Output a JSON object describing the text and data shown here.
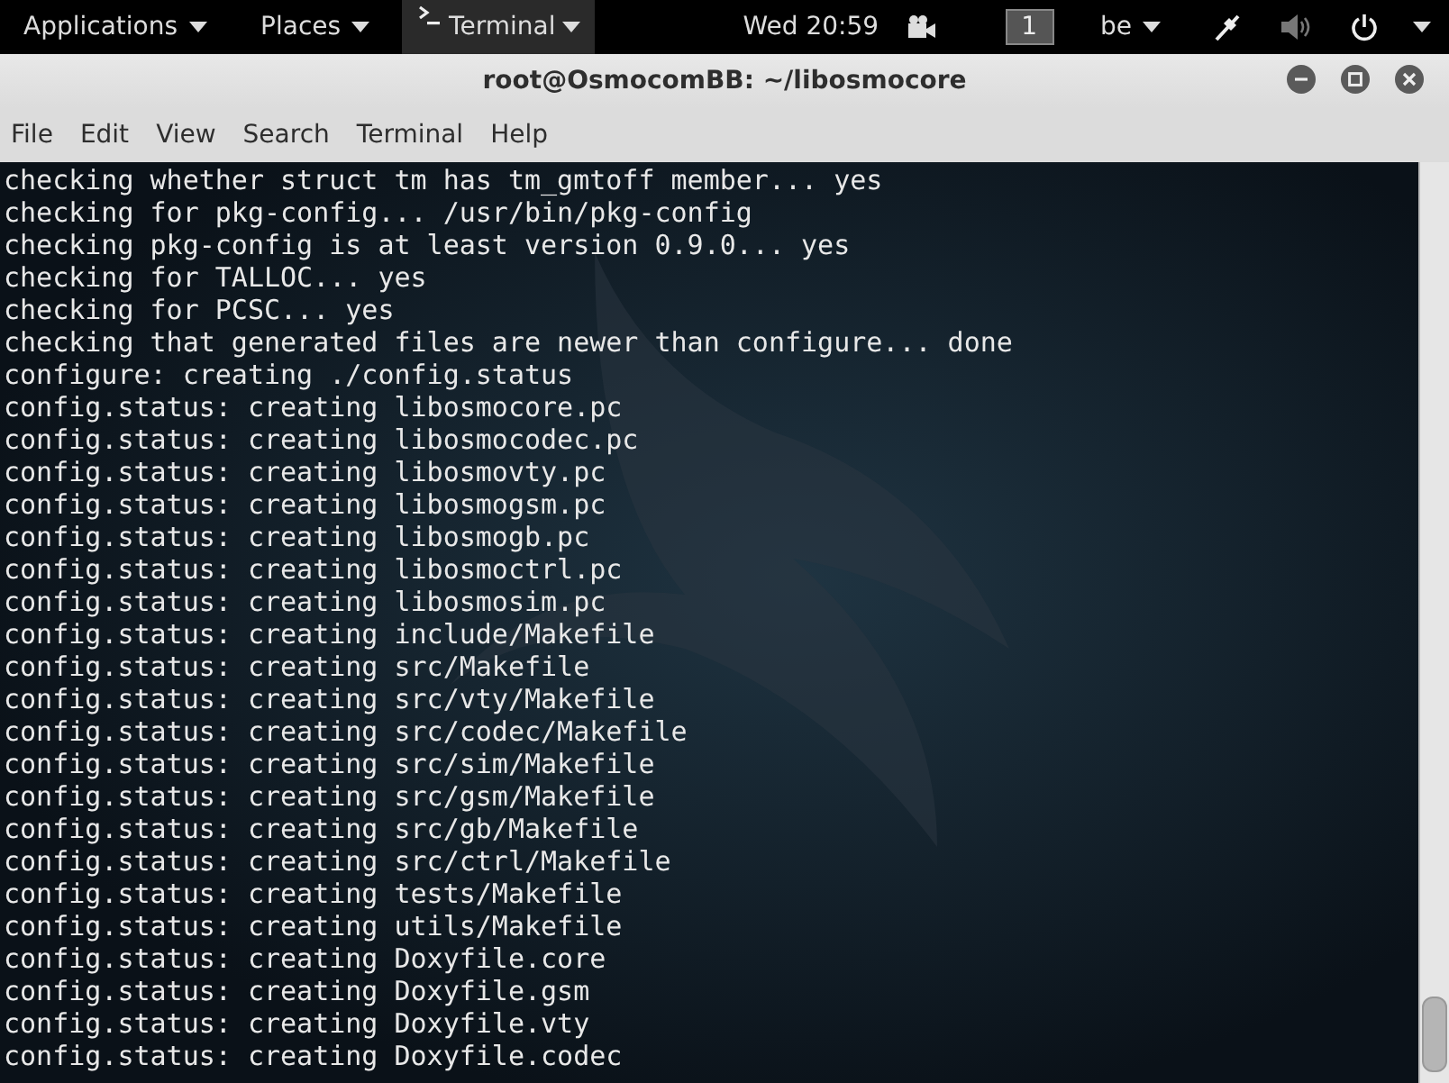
{
  "top_bar": {
    "applications": "Applications",
    "places": "Places",
    "app_menu": "Terminal",
    "clock": "Wed 20:59",
    "workspace": "1",
    "keyboard_layout": "be"
  },
  "window": {
    "title": "root@OsmocomBB: ~/libosmocore"
  },
  "menu": [
    "File",
    "Edit",
    "View",
    "Search",
    "Terminal",
    "Help"
  ],
  "terminal_lines": [
    "checking whether struct tm has tm_gmtoff member... yes",
    "checking for pkg-config... /usr/bin/pkg-config",
    "checking pkg-config is at least version 0.9.0... yes",
    "checking for TALLOC... yes",
    "checking for PCSC... yes",
    "checking that generated files are newer than configure... done",
    "configure: creating ./config.status",
    "config.status: creating libosmocore.pc",
    "config.status: creating libosmocodec.pc",
    "config.status: creating libosmovty.pc",
    "config.status: creating libosmogsm.pc",
    "config.status: creating libosmogb.pc",
    "config.status: creating libosmoctrl.pc",
    "config.status: creating libosmosim.pc",
    "config.status: creating include/Makefile",
    "config.status: creating src/Makefile",
    "config.status: creating src/vty/Makefile",
    "config.status: creating src/codec/Makefile",
    "config.status: creating src/sim/Makefile",
    "config.status: creating src/gsm/Makefile",
    "config.status: creating src/gb/Makefile",
    "config.status: creating src/ctrl/Makefile",
    "config.status: creating tests/Makefile",
    "config.status: creating utils/Makefile",
    "config.status: creating Doxyfile.core",
    "config.status: creating Doxyfile.gsm",
    "config.status: creating Doxyfile.vty",
    "config.status: creating Doxyfile.codec"
  ]
}
